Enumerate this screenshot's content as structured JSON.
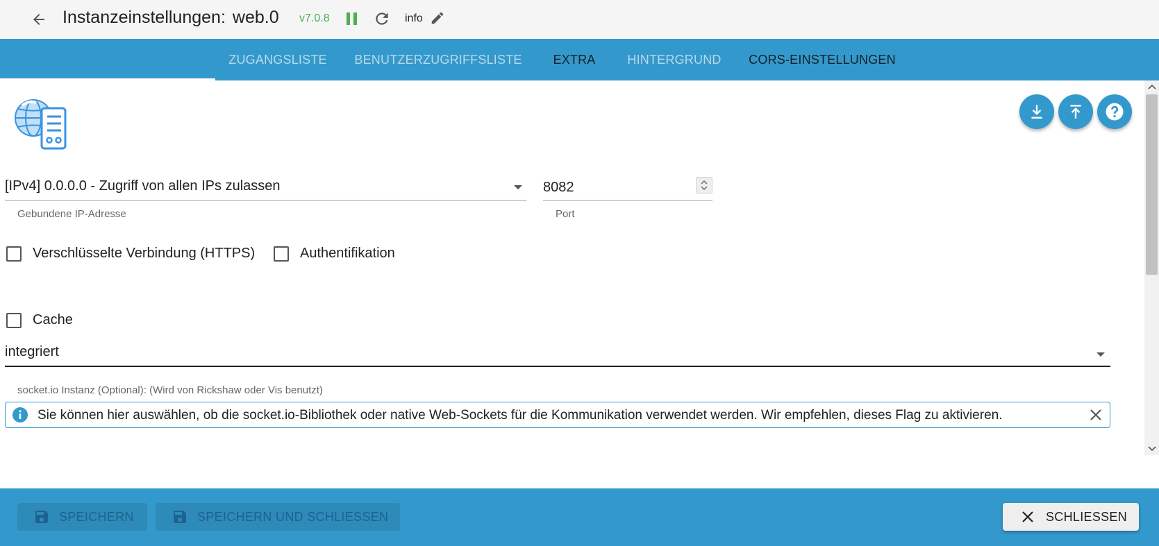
{
  "header": {
    "title_prefix": "Instanzeinstellungen:",
    "instance": "web.0",
    "version": "v7.0.8",
    "log_level": "info"
  },
  "tabs": [
    {
      "label": "ZUGANGSLISTE",
      "active": false
    },
    {
      "label": "BENUTZERZUGRIFFSLISTE",
      "active": false
    },
    {
      "label": "EXTRA",
      "active": true
    },
    {
      "label": "HINTERGRUND",
      "active": false
    },
    {
      "label": "CORS-EINSTELLUNGEN",
      "active": true
    }
  ],
  "form": {
    "bind_ip": {
      "value": "[IPv4] 0.0.0.0 - Zugriff von allen IPs zulassen",
      "helper": "Gebundene IP-Adresse"
    },
    "port": {
      "value": "8082",
      "helper": "Port"
    },
    "checkboxes": {
      "https": {
        "label": "Verschlüsselte Verbindung (HTTPS)",
        "checked": false
      },
      "auth": {
        "label": "Authentifikation",
        "checked": false
      },
      "cache": {
        "label": "Cache",
        "checked": false
      }
    },
    "socket_instance": {
      "value": "integriert",
      "helper": "socket.io Instanz (Optional): (Wird von Rickshaw oder Vis benutzt)"
    },
    "info_alert": "Sie können hier auswählen, ob die socket.io-Bibliothek oder native Web-Sockets für die Kommunikation verwendet werden. Wir empfehlen, dieses Flag zu aktivieren."
  },
  "footer": {
    "save_label": "SPEICHERN",
    "save_close_label": "SPEICHERN UND SCHLIESSEN",
    "close_label": "SCHLIESSEN"
  },
  "colors": {
    "primary": "#3399cc",
    "version_green": "#4caf50",
    "header_bg": "#f5f5f5"
  }
}
